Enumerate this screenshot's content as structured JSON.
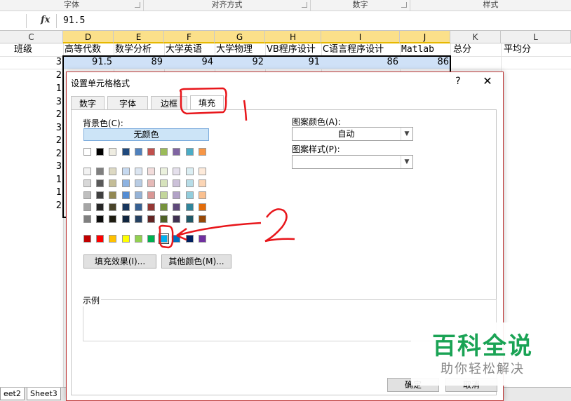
{
  "ribbon": {
    "groups": [
      "字体",
      "对齐方式",
      "数字",
      "样式"
    ]
  },
  "formula_bar": {
    "fx_label": "fx",
    "value": "91.5"
  },
  "columns": [
    "C",
    "D",
    "E",
    "F",
    "G",
    "H",
    "I",
    "J",
    "K",
    "L"
  ],
  "header_row": [
    "班级",
    "高等代数",
    "数学分析",
    "大学英语",
    "大学物理",
    "VB程序设计",
    "C语言程序设计",
    "Matlab",
    "总分",
    "平均分"
  ],
  "first_data_row": [
    "3",
    "91.5",
    "89",
    "94",
    "92",
    "91",
    "86",
    "86"
  ],
  "class_column_values": [
    "3",
    "2",
    "1",
    "3",
    "2",
    "3",
    "2",
    "2",
    "3",
    "1",
    "1",
    "2"
  ],
  "sheet_tabs": [
    "eet2",
    "Sheet3"
  ],
  "dialog": {
    "title": "设置单元格格式",
    "help": "?",
    "close": "✕",
    "tabs": [
      "数字",
      "字体",
      "边框",
      "填充"
    ],
    "background_label": "背景色(C):",
    "no_color": "无颜色",
    "pattern_color_label": "图案颜色(A):",
    "pattern_color_value": "自动",
    "pattern_style_label": "图案样式(P):",
    "fill_effects_button": "填充效果(I)...",
    "more_colors_button": "其他颜色(M)...",
    "sample_label": "示例",
    "ok_button": "确定",
    "cancel_button": "取消"
  },
  "palette": {
    "theme_row": [
      "#ffffff",
      "#000000",
      "#eeece1",
      "#1f497d",
      "#4f81bd",
      "#c0504d",
      "#9bbb59",
      "#8064a2",
      "#4bacc6",
      "#f79646"
    ],
    "tints": [
      [
        "#f2f2f2",
        "#7f7f7f",
        "#ddd9c3",
        "#c6d9f0",
        "#dbe5f1",
        "#f2dcdb",
        "#ebf1dd",
        "#e5e0ec",
        "#dbeef3",
        "#fdeada"
      ],
      [
        "#d8d8d8",
        "#595959",
        "#c4bd97",
        "#8db3e2",
        "#b8cce4",
        "#e5b9b7",
        "#d7e3bc",
        "#ccc1d9",
        "#b7dde8",
        "#fbd5b5"
      ],
      [
        "#bfbfbf",
        "#3f3f3f",
        "#938953",
        "#548dd4",
        "#95b3d7",
        "#d99694",
        "#c3d69b",
        "#b2a2c7",
        "#92cddc",
        "#fac08f"
      ],
      [
        "#a5a5a5",
        "#262626",
        "#494429",
        "#17365d",
        "#366092",
        "#953734",
        "#76923c",
        "#5f497a",
        "#31859b",
        "#e36c09"
      ],
      [
        "#7f7f7f",
        "#0c0c0c",
        "#1d1b10",
        "#0f243e",
        "#244061",
        "#632423",
        "#4f6128",
        "#3f3151",
        "#205867",
        "#974806"
      ]
    ],
    "standard_row": [
      "#c00000",
      "#ff0000",
      "#ffc000",
      "#ffff00",
      "#92d050",
      "#00b050",
      "#00b0f0",
      "#0070c0",
      "#002060",
      "#7030a0"
    ],
    "selected_standard_index": 6
  },
  "annotations": {
    "tab_marker": "1",
    "color_marker": "2",
    "ink_color": "#e8161b"
  },
  "watermark": {
    "title": "百科全说",
    "subtitle": "助你轻松解决",
    "color": "#1aa355"
  }
}
